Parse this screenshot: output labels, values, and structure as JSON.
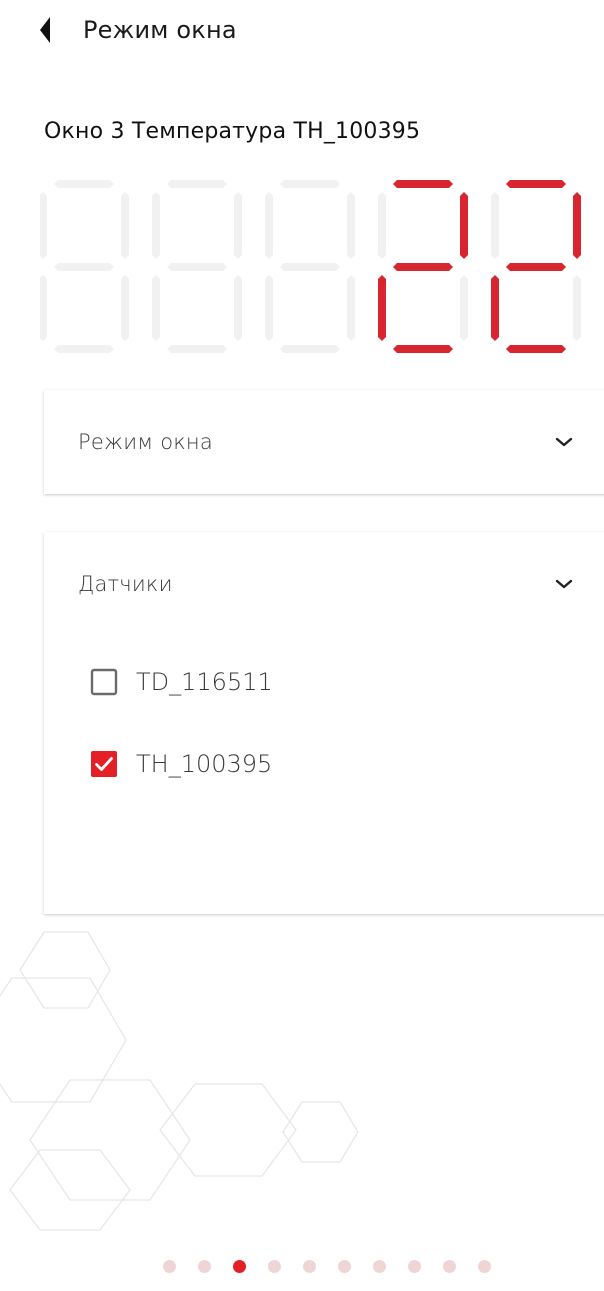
{
  "header": {
    "back_icon": "back-triangle-icon",
    "title": "Режим окна"
  },
  "window": {
    "title": "Окно 3 Температура TH_100395"
  },
  "display": {
    "value": "22",
    "digit_count": 5,
    "active_color": "#d7262f",
    "inactive_color": "#f1f1f1"
  },
  "mode_card": {
    "label": "Режим окна",
    "icon": "chevron-down-icon"
  },
  "sensors_card": {
    "label": "Датчики",
    "icon": "chevron-down-icon",
    "items": [
      {
        "label": "TD_116511",
        "checked": false
      },
      {
        "label": "TH_100395",
        "checked": true
      }
    ]
  },
  "pager": {
    "page_count": 10,
    "active_index": 2,
    "active_color": "#e41f26",
    "inactive_color": "#f0d5d7"
  },
  "colors": {
    "accent": "#e41f26",
    "checkbox_checked": "#e41f26",
    "checkbox_unchecked_border": "#6b6b6b"
  }
}
